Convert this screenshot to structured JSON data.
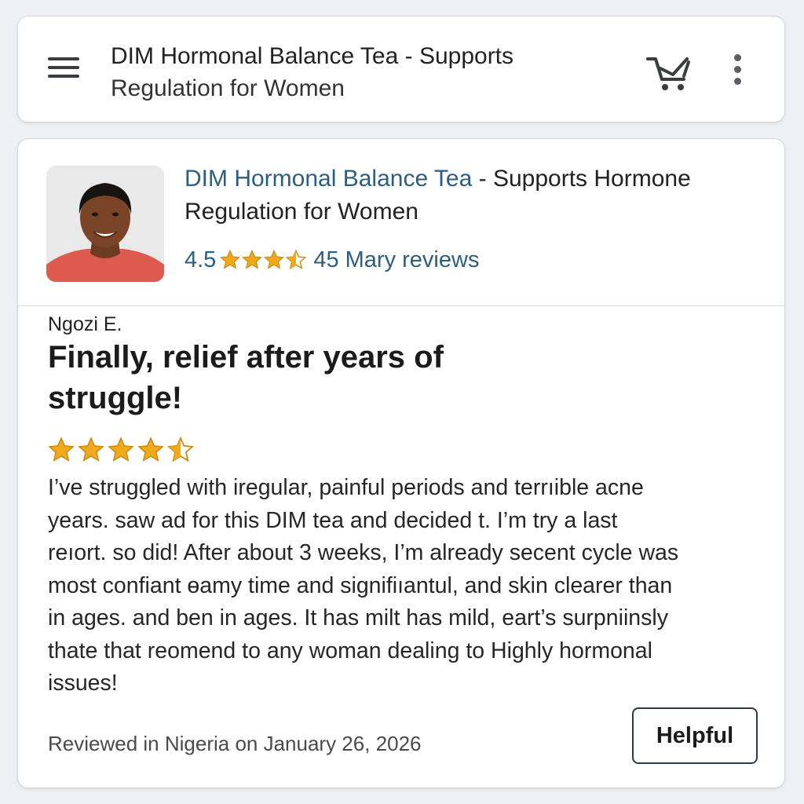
{
  "header": {
    "title_line1": "DIM Hormonal Balance Tea - Supports",
    "title_line2": "Regulation for Women",
    "icons": [
      "menu-icon",
      "cart-icon",
      "more-vertical-icon"
    ]
  },
  "product": {
    "title_link": "DIM Hormonal Balance Tea",
    "title_rest": " - Supports Hormone",
    "title_line2": "Regulation for Women",
    "rating_value": "4.5",
    "rating_stars": 4.5,
    "reviews_label": "45 Mary reviews"
  },
  "review": {
    "reviewer": "Ngozi E.",
    "title": "Finally, relief after years of struggle!",
    "stars": 4.5,
    "body_lines": [
      "I’ve struggled with iregular, painful periods and terrıible acne",
      "years. saw  ad  for this DIM tea and decided  t.  I’m try a last",
      "reıort. so did! After about 3 weeks, I’m already secent cycle was",
      "most confiant ɵamy time and signifiıantul, and skin clearer than",
      "in ages.   and ben in ages. It has milt has mild, eart’s surpniinsly",
      "thate that reomend to any woman dealing to Highly hormonal",
      "issues!"
    ],
    "meta": "Reviewed in Nigeria on January 26, 2026",
    "helpful_label": "Helpful"
  },
  "colors": {
    "link": "#2b5f82",
    "star": "#f0a91c",
    "star_outline": "#c98a10",
    "background": "#eef0f3"
  }
}
